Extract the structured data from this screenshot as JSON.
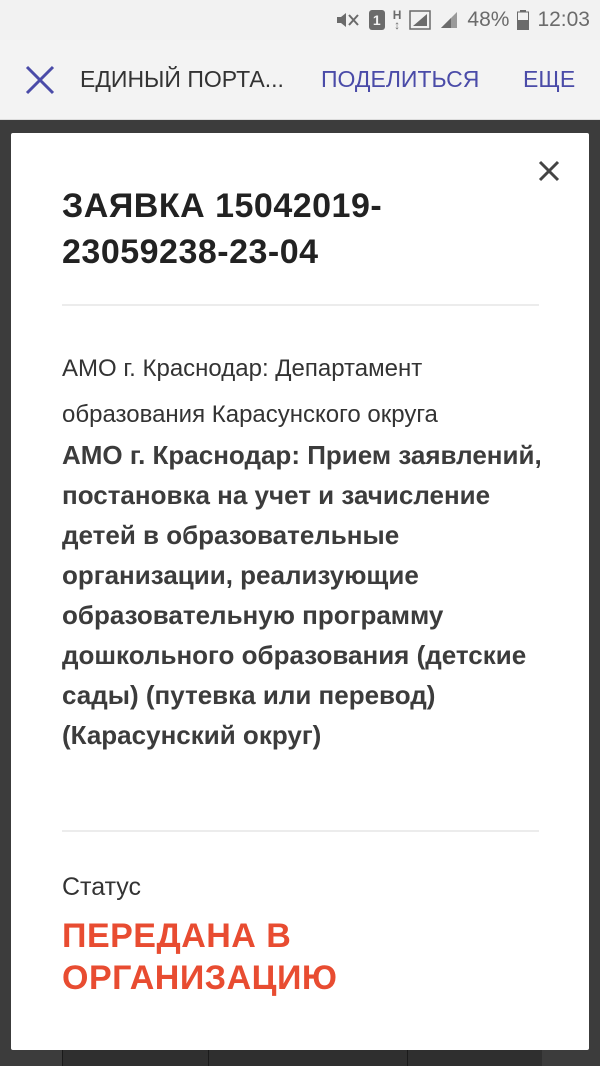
{
  "status_bar": {
    "sim_badge": "1",
    "network_type": "H",
    "battery": "48%",
    "time": "12:03"
  },
  "toolbar": {
    "title": "ЕДИНЫЙ ПОРТА...",
    "share_label": "ПОДЕЛИТЬСЯ",
    "more_label": "ЕЩЕ",
    "accent_color": "#4a4ba8"
  },
  "modal": {
    "heading": "ЗАЯВКА 15042019-23059238-23-04",
    "department": "АМО г. Краснодар: Департамент образования Карасунского округа",
    "service": "АМО г. Краснодар: Прием заявлений, постановка на учет и зачисление детей в образовательные организации, реализующие образовательную программу дошкольного образования (детские сады) (путевка или перевод) (Карасунский округ)",
    "status_label": "Статус",
    "status_value": "ПЕРЕДАНА В ОРГАНИЗАЦИЮ",
    "status_color": "#e84c31"
  }
}
